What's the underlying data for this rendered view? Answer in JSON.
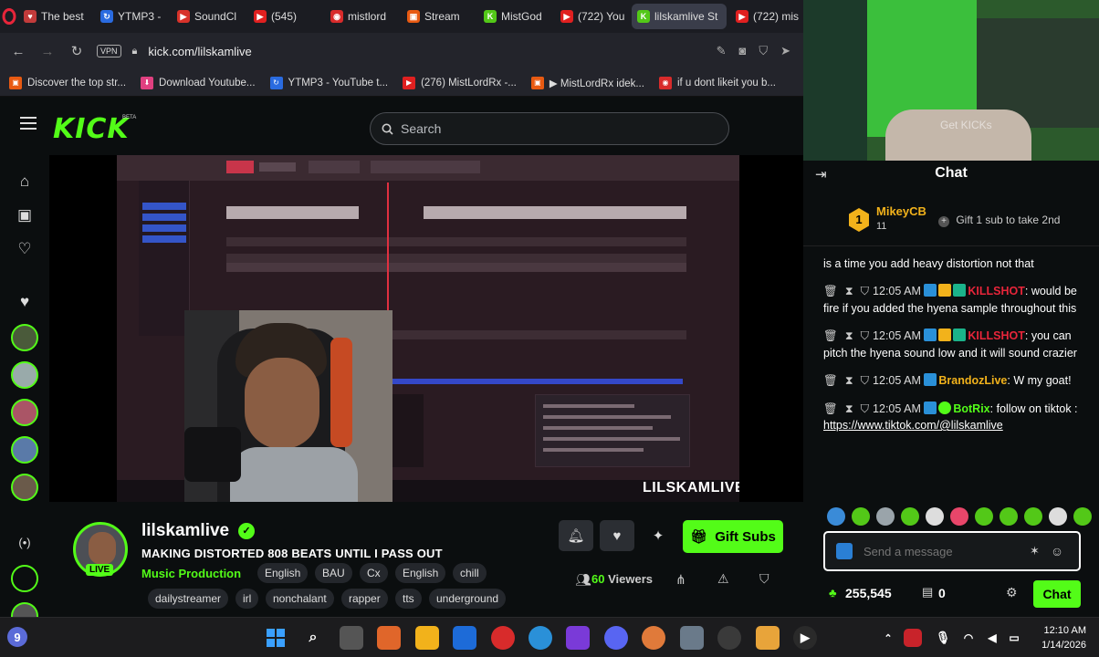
{
  "browser": {
    "tabs": [
      {
        "label": "The best",
        "color": "#c23b3b",
        "glyph": "♥"
      },
      {
        "label": "YTMP3 -",
        "color": "#2a6be0",
        "glyph": "↻"
      },
      {
        "label": "SoundCl",
        "color": "#d8322a",
        "glyph": "▶"
      },
      {
        "label": "(545)",
        "color": "#e02020",
        "glyph": "▶"
      },
      {
        "label": "mistlord",
        "color": "#d82b2b",
        "glyph": "◉"
      },
      {
        "label": "Stream",
        "color": "#e85a12",
        "glyph": "▣"
      },
      {
        "label": "MistGod",
        "color": "#53c818",
        "glyph": "K"
      },
      {
        "label": "(722) You",
        "color": "#e02020",
        "glyph": "▶"
      },
      {
        "label": "lilskamlive St",
        "color": "#53c818",
        "glyph": "K"
      },
      {
        "label": "(722) mis",
        "color": "#e02020",
        "glyph": "▶"
      }
    ],
    "vpn_label": "VPN",
    "url": "kick.com/lilskamlive",
    "bookmarks": [
      {
        "label": "Discover the top str...",
        "color": "#e85a12",
        "glyph": "▣"
      },
      {
        "label": "Download Youtube...",
        "color": "#e04080",
        "glyph": "⬇"
      },
      {
        "label": "YTMP3 - YouTube t...",
        "color": "#2a6be0",
        "glyph": "↻"
      },
      {
        "label": "(276) MistLordRx -...",
        "color": "#e02020",
        "glyph": "▶"
      },
      {
        "label": "▶ MistLordRx idek...",
        "color": "#e85a12",
        "glyph": "▣"
      },
      {
        "label": "if u dont likeit you b...",
        "color": "#d82b2b",
        "glyph": "◉"
      }
    ]
  },
  "kick": {
    "logo": "KICK",
    "beta": "BETA",
    "search_placeholder": "Search"
  },
  "stream": {
    "watermark": "LILSKAMLIVE",
    "streamer": "lilskamlive",
    "live_label": "LIVE",
    "title": "MAKING DISTORTED 808 BEATS UNTIL I PASS OUT",
    "category": "Music Production",
    "tags_row1": [
      "English",
      "BAU",
      "Cx",
      "English",
      "chill"
    ],
    "tags_row2": [
      "dailystreamer",
      "irl",
      "nonchalant",
      "rapper",
      "tts",
      "underground"
    ],
    "gift_subs": "Gift Subs",
    "viewers_count": "60",
    "viewers_label": "Viewers"
  },
  "chat": {
    "title": "Chat",
    "top_gifter": {
      "rank": "1",
      "name": "MikeyCB",
      "count": "11"
    },
    "gift_cta": "Gift 1 sub to take 2nd",
    "partial_message": "is a time you add heavy distortion not that",
    "messages": [
      {
        "time": "12:05 AM",
        "user": "KILLSHOT",
        "color": "#e8253a",
        "text": "would be fire if you added the hyena sample throughout this"
      },
      {
        "time": "12:05 AM",
        "user": "KILLSHOT",
        "color": "#e8253a",
        "text": "you can pitch the hyena sound low and it will sound crazier"
      },
      {
        "time": "12:05 AM",
        "user": "BrandozLive",
        "color": "#f2b21b",
        "text": "W my goat!"
      },
      {
        "time": "12:05 AM",
        "user": "BotRix",
        "color": "#53fc18",
        "text": "follow on tiktok : ",
        "link": "https://www.tiktok.com/@lilskamlive"
      }
    ],
    "input_placeholder": "Send a message",
    "kicks": "255,545",
    "drops": "0",
    "send_label": "Chat"
  },
  "preview_overlay": {
    "get_kicks": "Get KICKs"
  },
  "taskbar": {
    "time": "12:10 AM",
    "date": "1/14/2026"
  }
}
